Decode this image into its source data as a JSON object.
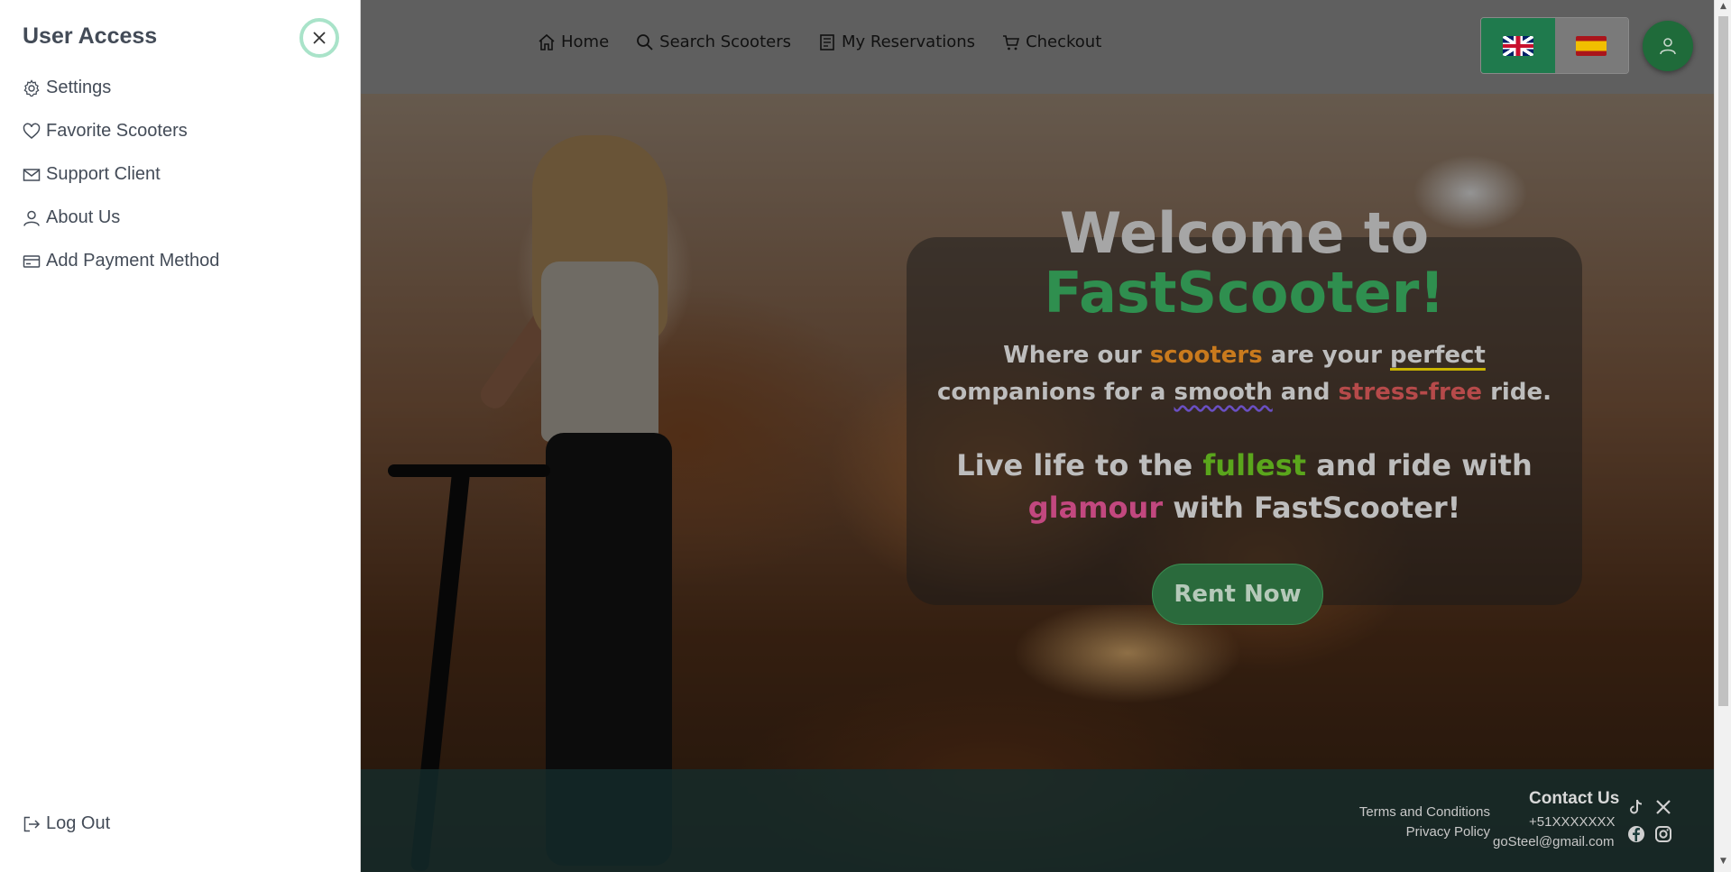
{
  "sidebar": {
    "title": "User Access",
    "items": [
      {
        "label": "Settings",
        "icon": "gear-icon"
      },
      {
        "label": "Favorite Scooters",
        "icon": "heart-icon"
      },
      {
        "label": "Support Client",
        "icon": "mail-icon"
      },
      {
        "label": "About Us",
        "icon": "user-icon"
      },
      {
        "label": "Add Payment Method",
        "icon": "credit-card-icon"
      }
    ],
    "logout": "Log Out"
  },
  "nav": {
    "items": [
      {
        "label": "Home",
        "icon": "house-icon"
      },
      {
        "label": "Search Scooters",
        "icon": "search-icon"
      },
      {
        "label": "My Reservations",
        "icon": "document-icon"
      },
      {
        "label": "Checkout",
        "icon": "cart-icon"
      }
    ]
  },
  "hero": {
    "title_line1": "Welcome to",
    "title_line2": "FastScooter!",
    "sub": {
      "p1": "Where our ",
      "scooters": "scooters",
      "p2": " are your ",
      "perfect": "perfect",
      "p3": "companions for a ",
      "smooth": "smooth",
      "p4": " and ",
      "stress": "stress-free",
      "p5": " ride."
    },
    "sub2": {
      "p1": "Live life to the ",
      "fullest": "fullest",
      "p2": " and ride with",
      "glamour": "glamour",
      "p3": " with FastScooter!"
    },
    "cta": "Rent Now"
  },
  "footer": {
    "terms": "Terms and Conditions",
    "privacy": "Privacy Policy",
    "contact_title": "Contact Us",
    "phone": "+51XXXXXXX",
    "email": "goSteel@gmail.com"
  },
  "colors": {
    "brand_green": "#2f8f4f",
    "active_lang_bg": "#1f7a4d",
    "close_ring": "#a9e3c9"
  }
}
